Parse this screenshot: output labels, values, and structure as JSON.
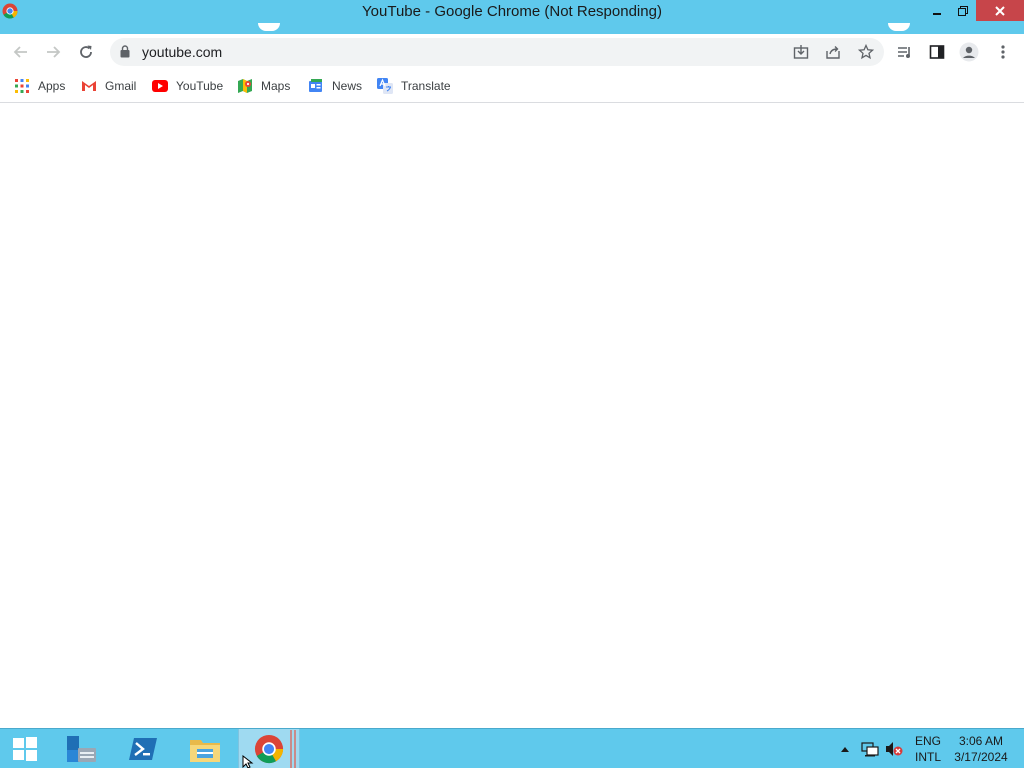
{
  "window": {
    "title": "YouTube - Google Chrome (Not Responding)",
    "minimize_icon": "minimize-icon",
    "restore_icon": "restore-icon",
    "close_icon": "close-icon"
  },
  "toolbar": {
    "url": "youtube.com",
    "icons": [
      "back-arrow-icon",
      "forward-arrow-icon",
      "reload-icon",
      "lock-icon",
      "install-icon",
      "share-icon",
      "star-icon",
      "media-queue-icon",
      "side-panel-icon",
      "profile-icon",
      "more-vert-icon"
    ]
  },
  "bookmarks": [
    {
      "label": "Apps",
      "icon": "apps-grid-icon"
    },
    {
      "label": "Gmail",
      "icon": "gmail-icon"
    },
    {
      "label": "YouTube",
      "icon": "youtube-icon"
    },
    {
      "label": "Maps",
      "icon": "maps-icon"
    },
    {
      "label": "News",
      "icon": "news-icon"
    },
    {
      "label": "Translate",
      "icon": "translate-icon"
    }
  ],
  "taskbar": {
    "apps": [
      "server-manager-icon",
      "powershell-icon",
      "file-explorer-icon",
      "chrome-icon"
    ],
    "tray_icons": [
      "show-hidden-icons-icon",
      "network-icon",
      "volume-muted-icon"
    ],
    "language": {
      "line1": "ENG",
      "line2": "INTL"
    },
    "clock": {
      "time": "3:06 AM",
      "date": "3/17/2024"
    }
  },
  "colors": {
    "titlebar": "#5fc9ec",
    "taskbar": "#5fc9ec",
    "close": "#c7454a"
  }
}
